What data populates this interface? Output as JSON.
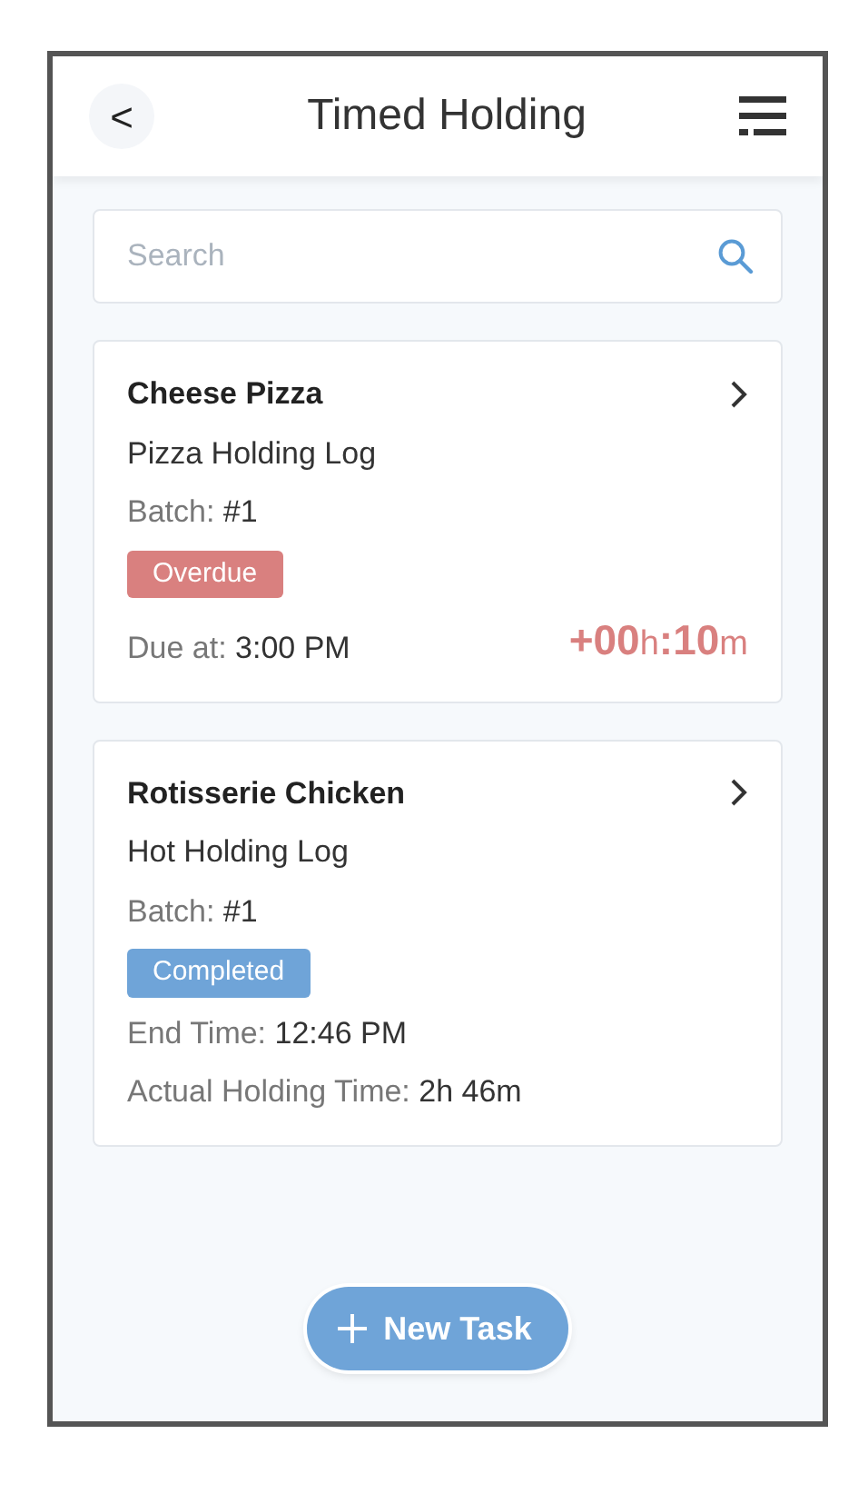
{
  "header": {
    "back": "<",
    "title": "Timed Holding"
  },
  "search": {
    "placeholder": "Search"
  },
  "tasks": [
    {
      "name": "Cheese Pizza",
      "log": "Pizza Holding Log",
      "details": [
        {
          "label": "Batch:",
          "value": "#1"
        }
      ],
      "status": {
        "kind": "overdue",
        "label": "Overdue"
      },
      "footer": [
        {
          "label": "Due at:",
          "value": "3:00 PM"
        }
      ],
      "timer": [
        {
          "kind": "value",
          "text": "+00"
        },
        {
          "kind": "unit",
          "text": "h"
        },
        {
          "kind": "value",
          "text": ":10"
        },
        {
          "kind": "unit",
          "text": "m"
        }
      ]
    },
    {
      "name": "Rotisserie Chicken",
      "log": "Hot Holding Log",
      "details": [
        {
          "label": "Batch:",
          "value": "#1"
        }
      ],
      "status": {
        "kind": "completed",
        "label": "Completed"
      },
      "footer": [
        {
          "label": "End Time:",
          "value": "12:46 PM"
        },
        {
          "label": "Actual Holding Time:",
          "value": "2h 46m"
        }
      ]
    }
  ],
  "fab": {
    "label": "New Task"
  }
}
